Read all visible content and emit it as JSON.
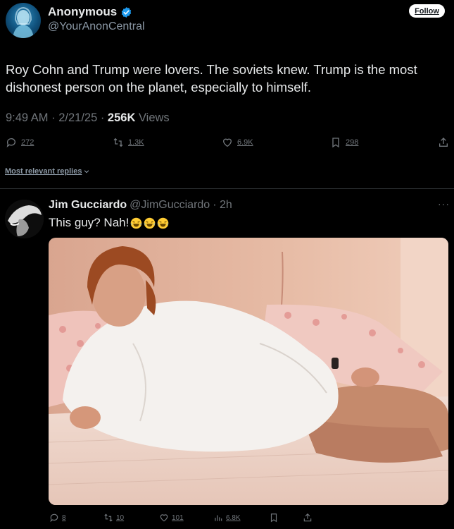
{
  "tweet": {
    "display_name": "Anonymous",
    "handle": "@YourAnonCentral",
    "follow_label": "Follow",
    "text": "Roy Cohn and Trump were lovers.  The soviets knew. Trump is the most dishonest person on the planet, especially to himself.",
    "time": "9:49 AM · 2/21/25 · ",
    "views_count": "256K",
    "views_label": " Views",
    "actions": {
      "replies": "272",
      "reposts": "1.3K",
      "likes": "6.9K",
      "bookmarks": "298"
    }
  },
  "sort_label": "Most relevant replies",
  "reply": {
    "display_name": "Jim Gucciardo",
    "handle": "@JimGucciardo",
    "time": "· 2h",
    "text": "This guy? Nah!",
    "emoji_count": 3,
    "more_label": "···",
    "actions": {
      "replies": "8",
      "reposts": "10",
      "likes": "101",
      "views": "6.8K"
    }
  },
  "colors": {
    "background": "#000000",
    "primary_text": "#e7e9ea",
    "secondary_text": "#71767b",
    "verified_blue": "#1d9bf0",
    "divider": "#2f3336"
  },
  "icons": [
    "verified-badge-icon",
    "reply-icon",
    "repost-icon",
    "like-icon",
    "bookmark-icon",
    "share-icon",
    "views-icon",
    "chevron-down-icon",
    "more-icon",
    "laughing-emoji-icon"
  ]
}
